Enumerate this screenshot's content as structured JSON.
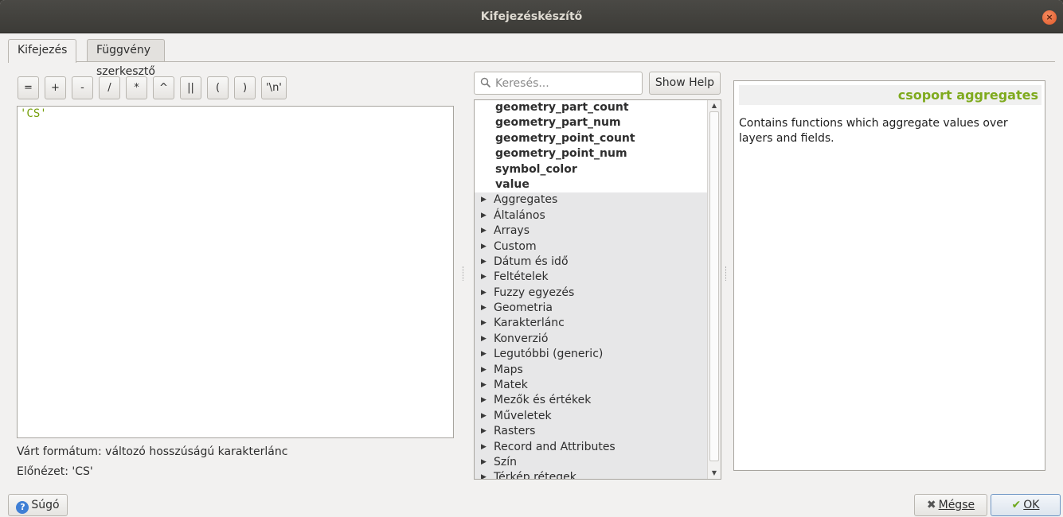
{
  "window": {
    "title": "Kifejezéskészítő",
    "close_glyph": "×"
  },
  "tabs": [
    {
      "label": "Kifejezés",
      "active": true
    },
    {
      "label": "Függvény szerkesztő",
      "active": false
    }
  ],
  "operators": [
    "=",
    "+",
    "-",
    "/",
    "*",
    "^",
    "||",
    "(",
    ")",
    "'\\n'"
  ],
  "editor": {
    "code": "'CS'"
  },
  "status": {
    "expected_format": "Várt formátum: változó hosszúságú karakterlánc",
    "preview": "Előnézet: 'CS'"
  },
  "search": {
    "placeholder": "Keresés...",
    "value": ""
  },
  "show_help_label": "Show Help",
  "tree": {
    "fields": [
      "geometry_part_count",
      "geometry_part_num",
      "geometry_point_count",
      "geometry_point_num",
      "symbol_color",
      "value"
    ],
    "groups": [
      "Aggregates",
      "Általános",
      "Arrays",
      "Custom",
      "Dátum és idő",
      "Feltételek",
      "Fuzzy egyezés",
      "Geometria",
      "Karakterlánc",
      "Konverzió",
      "Legutóbbi (generic)",
      "Maps",
      "Matek",
      "Mezők és értékek",
      "Műveletek",
      "Rasters",
      "Record and Attributes",
      "Szín",
      "Térkép rétegek"
    ]
  },
  "help_panel": {
    "heading": "csoport aggregates",
    "text": "Contains functions which aggregate values over layers and fields."
  },
  "buttons": {
    "help": "Súgó",
    "cancel": "Mégse",
    "ok": "OK"
  },
  "colors": {
    "accent_green": "#7faa1e",
    "titlebar": "#3c3b37",
    "close_button": "#e15a2a"
  }
}
